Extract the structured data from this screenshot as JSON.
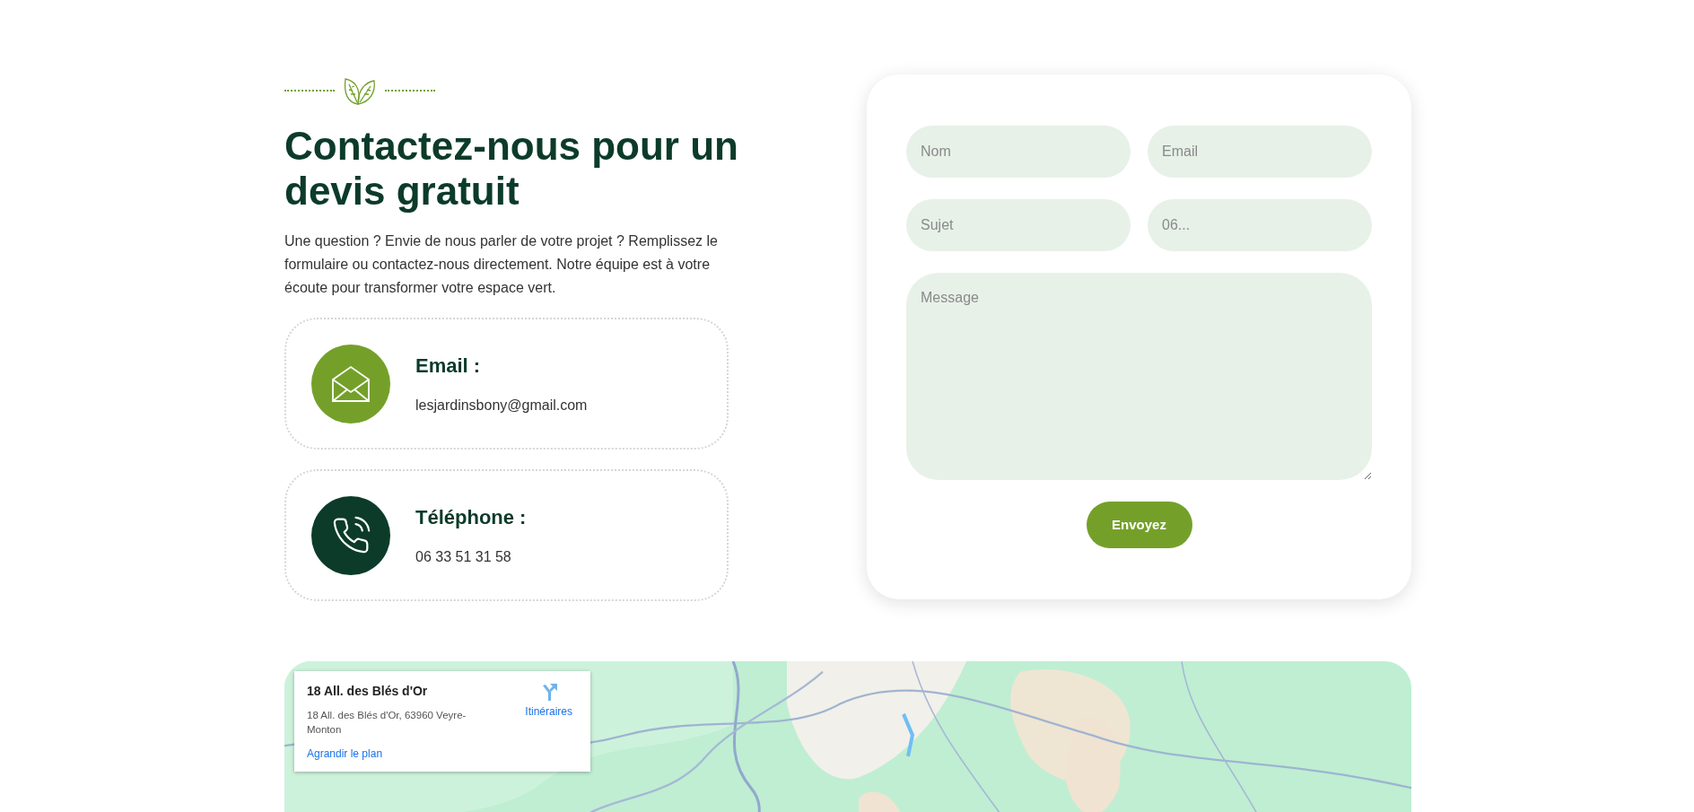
{
  "intro": {
    "title": "Contactez-nous pour un devis gratuit",
    "text": "Une question ? Envie de nous parler de votre projet ? Remplissez le formulaire ou contactez-nous directement. Notre équipe est à votre écoute pour transformer votre espace vert."
  },
  "contacts": [
    {
      "kind": "email",
      "label": "Email :",
      "value": "lesjardinsbony@gmail.com",
      "color": "#74a02a"
    },
    {
      "kind": "phone",
      "label": "Téléphone :",
      "value": "06 33 51 31 58",
      "color": "#0c3b2a"
    }
  ],
  "form": {
    "fields": [
      {
        "placeholder": "Nom"
      },
      {
        "placeholder": "Email"
      },
      {
        "placeholder": "Sujet"
      },
      {
        "placeholder": "06..."
      }
    ],
    "message": {
      "placeholder": "Message"
    },
    "submit": "Envoyez"
  },
  "map": {
    "kind": "picture",
    "card": {
      "title": "18 All. des Blés d'Or",
      "address": "18 All. des Blés d'Or, 63960 Veyre-Monton",
      "directions": "Itinéraires",
      "enlarge": "Agrandir le plan"
    }
  }
}
